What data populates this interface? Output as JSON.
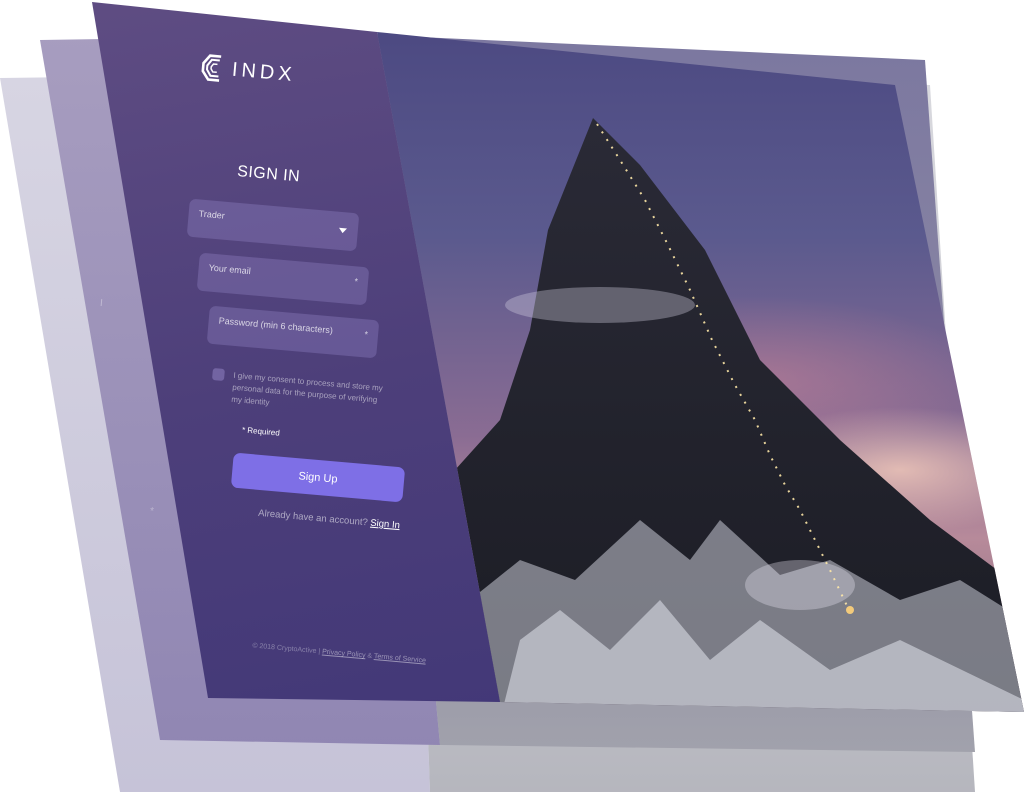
{
  "brand": {
    "logo_text": "INDX"
  },
  "form": {
    "title": "SIGN IN",
    "role_select": {
      "value": "Trader"
    },
    "email": {
      "placeholder": "Your email",
      "required_mark": "*"
    },
    "password": {
      "placeholder": "Password (min 6 characters)",
      "required_mark": "*"
    },
    "consent_text": "I give my consent to process and store my personal data for the purpose of verifying my identity",
    "required_note": "* Required",
    "submit_label": "Sign Up",
    "signin_prompt": "Already have an account?",
    "signin_link": "Sign In"
  },
  "footer": {
    "copyright": "© 2018 CryptoActive |",
    "privacy_link": "Privacy Policy",
    "separator": "&",
    "terms_link": "Terms of Service"
  },
  "icons": {
    "dropdown": "chevron-down-icon",
    "logo": "cindx-logo-icon"
  },
  "colors": {
    "panel": "#4d3f7a",
    "button": "#7e6fe6",
    "sky": "#5b5a8e"
  }
}
